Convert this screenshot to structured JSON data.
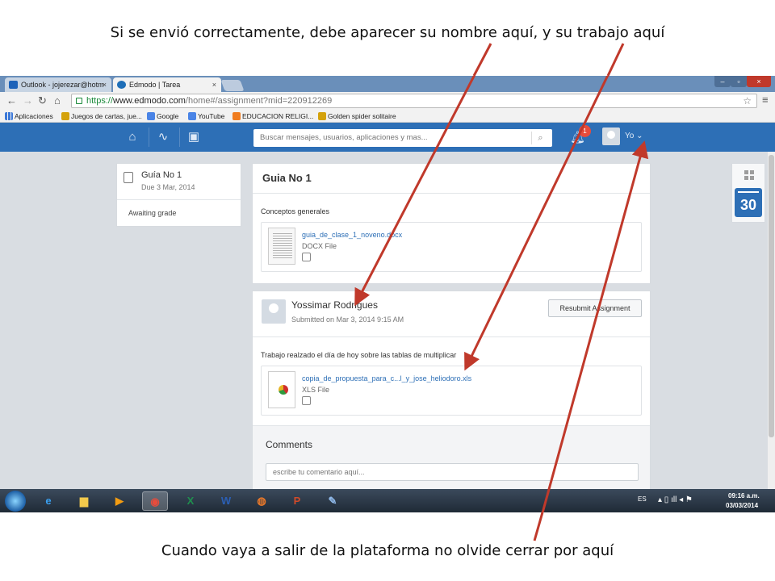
{
  "captions": {
    "top": "Si se envió correctamente, debe aparecer su nombre aquí, y su trabajo aquí",
    "bottom": "Cuando vaya a salir de la plataforma no olvide cerrar por aquí"
  },
  "browser": {
    "tabs": [
      {
        "label": "Outlook - jojerezar@hotm",
        "close": "×"
      },
      {
        "label": "Edmodo | Tarea",
        "close": "×"
      }
    ],
    "url_scheme": "https://",
    "url_host": "www.edmodo.com",
    "url_path": "/home#/assignment?mid=220912269",
    "bookmarks": [
      {
        "label": "Aplicaciones",
        "icon": "apps-grid-icon"
      },
      {
        "label": "Juegos de cartas, jue...",
        "icon": "game-icon"
      },
      {
        "label": "Google",
        "icon": "google-icon"
      },
      {
        "label": "YouTube",
        "icon": "youtube-icon"
      },
      {
        "label": "EDUCACION RELIGI...",
        "icon": "blogger-icon"
      },
      {
        "label": "Golden spider solitaire",
        "icon": "game-icon"
      }
    ]
  },
  "appbar": {
    "search_placeholder": "Buscar mensajes, usuarios, aplicaciones y mas...",
    "notification_count": "1",
    "user_label": "Yo",
    "user_chevron": "⌄"
  },
  "assignment_card": {
    "title": "Guía No 1",
    "due": "Due 3 Mar, 2014",
    "status": "Awaiting grade"
  },
  "assignment": {
    "title": "Guia No 1",
    "section_label": "Conceptos generales",
    "file": {
      "name": "guia_de_clase_1_noveno.docx",
      "type": "DOCX File"
    }
  },
  "submission": {
    "student": "Yossimar Rodrigues",
    "submitted": "Submitted on Mar 3, 2014 9:15 AM",
    "resubmit_label": "Resubmit Assignment",
    "description": "Trabajo realzado el día de hoy sobre las tablas de multiplicar",
    "file": {
      "name": "copia_de_propuesta_para_c...l_y_jose_heliodoro.xls",
      "type": "XLS File"
    },
    "comments_title": "Comments",
    "comment_placeholder": "escribe tu comentario aquí..."
  },
  "calendar": {
    "day": "30"
  },
  "taskbar": {
    "lang": "ES",
    "time": "09:16 a.m.",
    "date": "03/03/2014",
    "apps": [
      {
        "name": "ie",
        "glyph": "e",
        "color": "#3aa0f0"
      },
      {
        "name": "explorer",
        "glyph": "▆",
        "color": "#f2c94c"
      },
      {
        "name": "media-player",
        "glyph": "▶",
        "color": "#f39c12"
      },
      {
        "name": "chrome",
        "glyph": "◉",
        "color": "#e74c3c"
      },
      {
        "name": "excel",
        "glyph": "X",
        "color": "#1f8f4e"
      },
      {
        "name": "word",
        "glyph": "W",
        "color": "#2b5fb4"
      },
      {
        "name": "firefox",
        "glyph": "◍",
        "color": "#e8782a"
      },
      {
        "name": "powerpoint",
        "glyph": "P",
        "color": "#d04a2a"
      },
      {
        "name": "paint",
        "glyph": "✎",
        "color": "#8fb8e8"
      }
    ]
  },
  "colors": {
    "accent": "#2d6fb6",
    "arrow": "#c0392b"
  }
}
